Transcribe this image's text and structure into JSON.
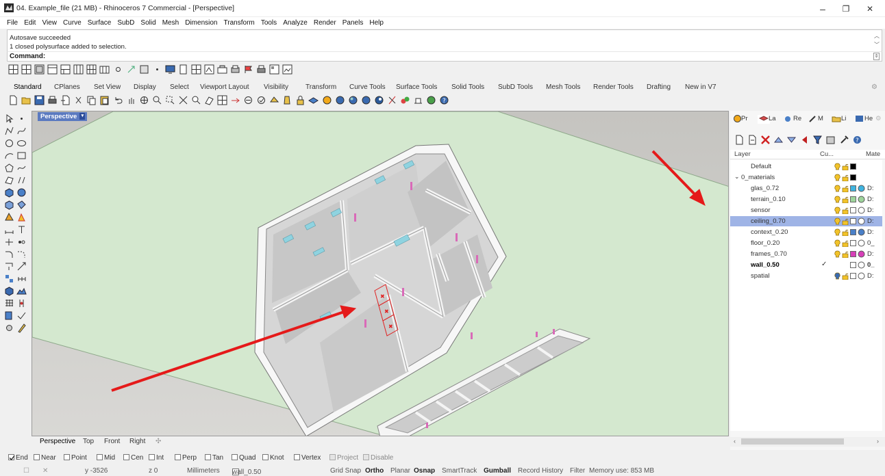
{
  "window": {
    "title": "04. Example_file (21 MB) - Rhinoceros 7 Commercial - [Perspective]",
    "minimize": "–",
    "restore": "❐",
    "close": "✕"
  },
  "menu": [
    "File",
    "Edit",
    "View",
    "Curve",
    "Surface",
    "SubD",
    "Solid",
    "Mesh",
    "Dimension",
    "Transform",
    "Tools",
    "Analyze",
    "Render",
    "Panels",
    "Help"
  ],
  "history": [
    "Autosave succeeded",
    "1 closed polysurface added to selection."
  ],
  "command": {
    "label": "Command:",
    "value": ""
  },
  "toolbar_tabs": [
    "Standard",
    "CPlanes",
    "Set View",
    "Display",
    "Select",
    "Viewport Layout",
    "Visibility",
    "Transform",
    "Curve Tools",
    "Surface Tools",
    "Solid Tools",
    "SubD Tools",
    "Mesh Tools",
    "Render Tools",
    "Drafting",
    "New in V7"
  ],
  "viewport": {
    "title": "Perspective",
    "dropdown": "▾"
  },
  "viewport_tabs": [
    "Perspective",
    "Top",
    "Front",
    "Right",
    "✣"
  ],
  "panel_tabs": [
    "Pr",
    "La",
    "Re",
    "M",
    "Li",
    "He"
  ],
  "layer_table": {
    "headers": {
      "layer": "Layer",
      "current": "Cu...",
      "material": "Mate"
    },
    "rows": [
      {
        "name": "Default",
        "indent": 0,
        "color": "#000000",
        "material": ""
      },
      {
        "name": "0_materials",
        "indent": 0,
        "color": "#000000",
        "material": ""
      },
      {
        "name": "glas_0.72",
        "indent": 1,
        "color": "#3fb4e0",
        "material": "D:"
      },
      {
        "name": "terrain_0.10",
        "indent": 1,
        "color": "#9ed49b",
        "material": "D:"
      },
      {
        "name": "sensor",
        "indent": 1,
        "color": "#ffffff",
        "material": "D:"
      },
      {
        "name": "ceiling_0.70",
        "indent": 1,
        "color": "#ffffff",
        "material": "D:",
        "selected": true
      },
      {
        "name": "context_0.20",
        "indent": 1,
        "color": "#4a80c8",
        "material": "D:"
      },
      {
        "name": "floor_0.20",
        "indent": 1,
        "color": "#ffffff",
        "material": "0_"
      },
      {
        "name": "frames_0.70",
        "indent": 1,
        "color": "#d640b8",
        "material": "D:"
      },
      {
        "name": "wall_0.50",
        "indent": 1,
        "color": "#ffffff",
        "material": "0_",
        "current": true,
        "check": "✓"
      },
      {
        "name": "spatial",
        "indent": 1,
        "color": "#ffffff",
        "material": "D:"
      }
    ]
  },
  "osnaps": [
    {
      "label": "End",
      "checked": true
    },
    {
      "label": "Near",
      "checked": false
    },
    {
      "label": "Point",
      "checked": false
    },
    {
      "label": "Mid",
      "checked": false
    },
    {
      "label": "Cen",
      "checked": false
    },
    {
      "label": "Int",
      "checked": false
    },
    {
      "label": "Perp",
      "checked": false
    },
    {
      "label": "Tan",
      "checked": false
    },
    {
      "label": "Quad",
      "checked": false
    },
    {
      "label": "Knot",
      "checked": false
    },
    {
      "label": "Vertex",
      "checked": false
    },
    {
      "label": "Project",
      "checked": false,
      "disabled": true
    },
    {
      "label": "Disable",
      "checked": false,
      "disabled": true
    }
  ],
  "status": {
    "y": "y -3526",
    "z": "z 0",
    "units": "Millimeters",
    "layer": "wall_0.50",
    "grid_snap": "Grid Snap",
    "ortho": "Ortho",
    "planar": "Planar",
    "osnap": "Osnap",
    "smarttrack": "SmartTrack",
    "gumball": "Gumball",
    "record_history": "Record History",
    "filter": "Filter",
    "memory": "Memory use: 853 MB"
  },
  "colors": {
    "accent": "#5b7ac0",
    "selection": "#9fb4e6",
    "terrain": "#d4e8cf",
    "annotation_arrow": "#e51a1a"
  }
}
